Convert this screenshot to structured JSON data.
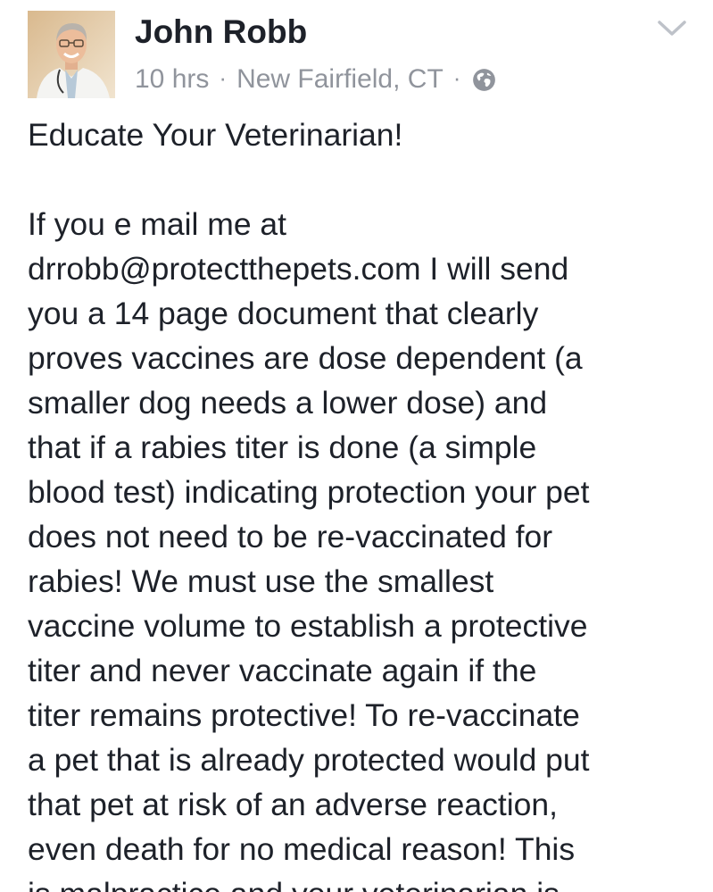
{
  "post": {
    "author": "John Robb",
    "time": "10 hrs",
    "separator": "·",
    "location": "New Fairfield, CT",
    "separator2": "·",
    "privacy_icon": "globe-icon",
    "options_icon": "chevron-down-icon",
    "headline": "Educate Your Veterinarian!",
    "body": "If you  e mail me at\ndrrobb@protectthepets.com I will send\nyou a 14 page document that clearly\nproves vaccines are dose dependent (a\nsmaller dog needs a lower dose) and\nthat if a rabies titer is done (a simple\nblood test) indicating protection your pet\ndoes not need to be re-vaccinated for\nrabies! We must use the smallest\nvaccine volume to establish a protective\ntiter and never vaccinate again if the\ntiter remains protective! To re-vaccinate\na pet that is already protected would put\nthat pet at risk of an adverse reaction,\neven death for no medical reason! This\nis malpractice and your veterinarian is"
  },
  "colors": {
    "text": "#1d2129",
    "meta": "#90949c",
    "chevron": "#bec2c9"
  }
}
